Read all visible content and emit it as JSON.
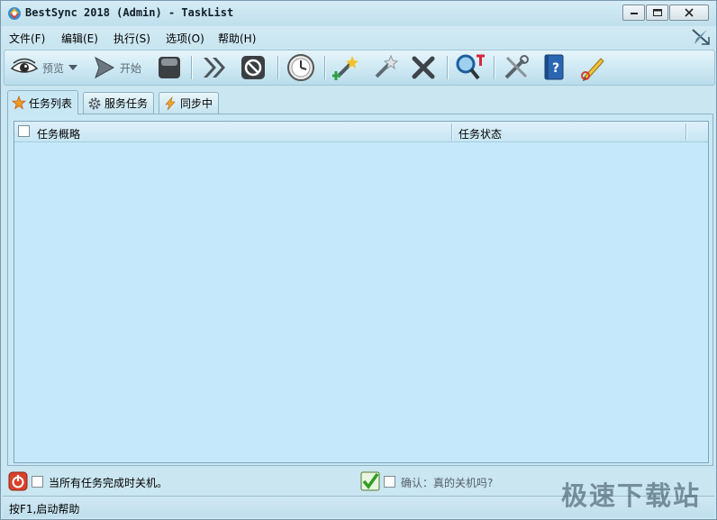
{
  "window": {
    "title": "BestSync 2018 (Admin) - TaskList",
    "minimize_icon": "minimize-icon",
    "maximize_icon": "restore-icon",
    "close_icon": "close-icon"
  },
  "menu": {
    "items": [
      {
        "label": "文件(F)"
      },
      {
        "label": "编辑(E)"
      },
      {
        "label": "执行(S)"
      },
      {
        "label": "选项(O)"
      },
      {
        "label": "帮助(H)"
      }
    ]
  },
  "toolbar": {
    "preview_label": "预览",
    "start_label": "开始",
    "icons": [
      "eye-icon",
      "play-icon",
      "stop-icon",
      "fast-forward-icon",
      "cancel-icon",
      "clock-icon",
      "new-task-icon",
      "edit-task-icon",
      "delete-icon",
      "search-icon",
      "settings-icon",
      "help-book-icon",
      "pencil-icon"
    ]
  },
  "tabs": [
    {
      "label": "任务列表",
      "active": true
    },
    {
      "label": "服务任务",
      "active": false
    },
    {
      "label": "同步中",
      "active": false
    }
  ],
  "list": {
    "columns": [
      "任务概略",
      "任务状态"
    ],
    "rows": []
  },
  "options": {
    "shutdown_label": "当所有任务完成时关机。",
    "confirm_label": "确认：真的关机吗?",
    "shutdown_checked": false,
    "confirm_checked": false
  },
  "status": {
    "text": "按F1,启动帮助"
  },
  "watermark": "极速下载站",
  "colors": {
    "accent": "#c5e9fa",
    "chrome": "#c9e6f1"
  }
}
